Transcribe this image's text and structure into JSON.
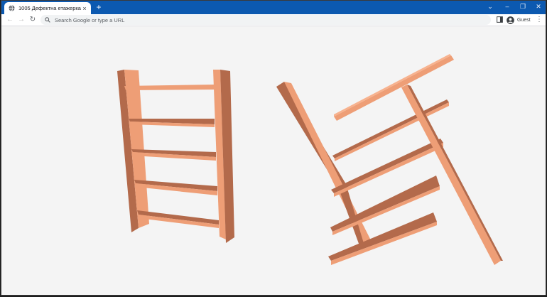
{
  "browser": {
    "tab_title": "1005 Дефектна етажерка.html",
    "tab_close": "×",
    "new_tab": "+",
    "omnibox_placeholder": "Search Google or type a URL",
    "profile_label": "Guest",
    "controls": {
      "dropdown": "⌄",
      "minimize": "–",
      "maximize": "❐",
      "close": "✕"
    },
    "nav": {
      "back": "←",
      "forward": "→",
      "reload": "↻",
      "menu": "⋮"
    }
  },
  "scene": {
    "shelf_color": "#ee9e76",
    "shelf_dark_color": "#b36a4b",
    "shelf_light_color": "#f7b28e",
    "background_color": "#f4f4f4"
  }
}
